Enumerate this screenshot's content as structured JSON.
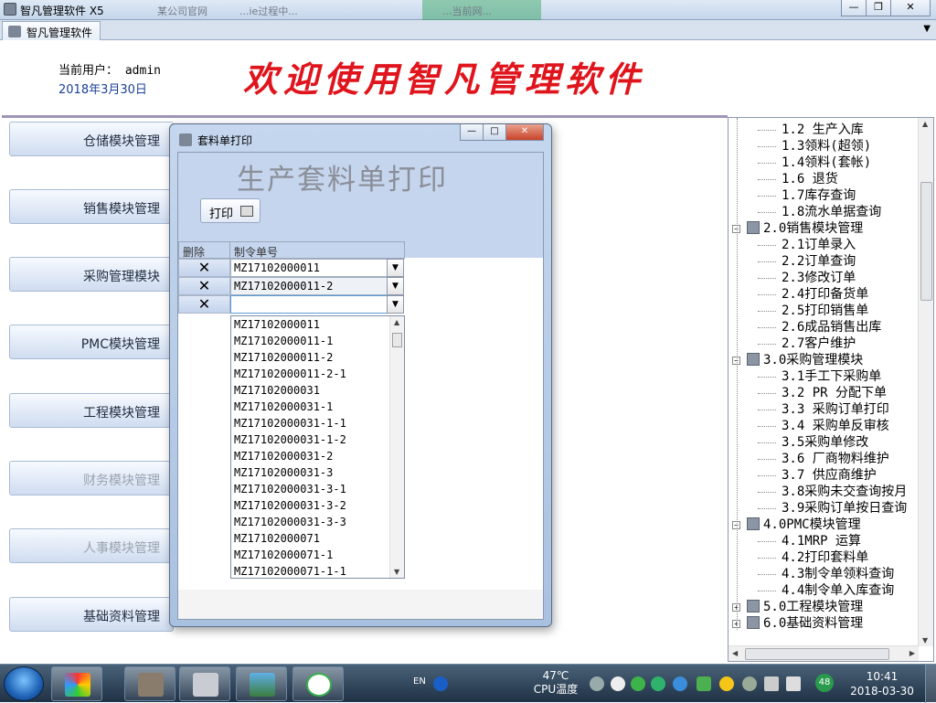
{
  "window": {
    "title": "智凡管理软件 X5",
    "background_tabs": [
      "某公司官网",
      "...ie过程中...",
      "...当前网..."
    ],
    "controls": {
      "minimize": "—",
      "restore": "❐",
      "close": "✕"
    }
  },
  "tab": {
    "label": "智凡管理软件"
  },
  "header": {
    "user_label": "当前用户：",
    "user": "admin",
    "date": "2018年3月30日",
    "welcome": "欢迎使用智凡管理软件"
  },
  "modules": [
    {
      "label": "仓储模块管理",
      "dim": false
    },
    {
      "label": "销售模块管理",
      "dim": false
    },
    {
      "label": "采购管理模块",
      "dim": false
    },
    {
      "label": "PMC模块管理",
      "dim": false
    },
    {
      "label": "工程模块管理",
      "dim": false
    },
    {
      "label": "财务模块管理",
      "dim": true
    },
    {
      "label": "人事模块管理",
      "dim": true
    },
    {
      "label": "基础资料管理",
      "dim": false
    }
  ],
  "tree": {
    "items": [
      {
        "text": "1.2 生产入库",
        "level": 2
      },
      {
        "text": "1.3领料(超领)",
        "level": 2
      },
      {
        "text": "1.4领料(套帐)",
        "level": 2
      },
      {
        "text": "1.6 退货",
        "level": 2
      },
      {
        "text": "1.7库存查询",
        "level": 2
      },
      {
        "text": "1.8流水单据查询",
        "level": 2
      },
      {
        "text": "2.0销售模块管理",
        "level": 1,
        "expander": "−"
      },
      {
        "text": "2.1订单录入",
        "level": 2
      },
      {
        "text": "2.2订单查询",
        "level": 2
      },
      {
        "text": "2.3修改订单",
        "level": 2
      },
      {
        "text": "2.4打印备货单",
        "level": 2
      },
      {
        "text": "2.5打印销售单",
        "level": 2
      },
      {
        "text": "2.6成品销售出库",
        "level": 2
      },
      {
        "text": "2.7客户维护",
        "level": 2
      },
      {
        "text": "3.0采购管理模块",
        "level": 1,
        "expander": "−"
      },
      {
        "text": "3.1手工下采购单",
        "level": 2
      },
      {
        "text": "3.2 PR 分配下单",
        "level": 2
      },
      {
        "text": "3.3 采购订单打印",
        "level": 2
      },
      {
        "text": "3.4 采购单反审核",
        "level": 2
      },
      {
        "text": "3.5采购单修改",
        "level": 2
      },
      {
        "text": "3.6 厂商物料维护",
        "level": 2
      },
      {
        "text": "3.7 供应商维护",
        "level": 2
      },
      {
        "text": "3.8采购未交查询按月",
        "level": 2
      },
      {
        "text": "3.9采购订单按日查询",
        "level": 2
      },
      {
        "text": "4.0PMC模块管理",
        "level": 1,
        "expander": "−"
      },
      {
        "text": "4.1MRP 运算",
        "level": 2
      },
      {
        "text": "4.2打印套料单",
        "level": 2
      },
      {
        "text": "4.3制令单领料查询",
        "level": 2
      },
      {
        "text": "4.4制令单入库查询",
        "level": 2
      },
      {
        "text": "5.0工程模块管理",
        "level": 1,
        "expander": "+"
      },
      {
        "text": "6.0基础资料管理",
        "level": 1,
        "expander": "+"
      }
    ]
  },
  "dialog": {
    "title": "套料单打印",
    "heading": "生产套料单打印",
    "print_button": "打印",
    "columns": {
      "delete": "删除",
      "order_no": "制令单号"
    },
    "rows": [
      {
        "delete": "✕",
        "value": "MZ17102000011"
      },
      {
        "delete": "✕",
        "value": "MZ17102000011-2"
      },
      {
        "delete": "✕",
        "value": ""
      }
    ],
    "dropdown_arrow": "▼",
    "dropdown_options": [
      "MZ17102000011",
      "MZ17102000011-1",
      "MZ17102000011-2",
      "MZ17102000011-2-1",
      "MZ17102000031",
      "MZ17102000031-1",
      "MZ17102000031-1-1",
      "MZ17102000031-1-2",
      "MZ17102000031-2",
      "MZ17102000031-3",
      "MZ17102000031-3-1",
      "MZ17102000031-3-2",
      "MZ17102000031-3-3",
      "MZ17102000071",
      "MZ17102000071-1",
      "MZ17102000071-1-1"
    ],
    "controls": {
      "minimize": "—",
      "maximize": "□",
      "close": "✕"
    }
  },
  "taskbar": {
    "lang": "EN",
    "temperature": "47℃",
    "temperature_label": "CPU温度",
    "volume_badge": "48",
    "time": "10:41",
    "date": "2018-03-30"
  },
  "colors": {
    "welcome": "#e0141c",
    "date": "#1a3f9a",
    "accent": "#c6d5ee"
  }
}
